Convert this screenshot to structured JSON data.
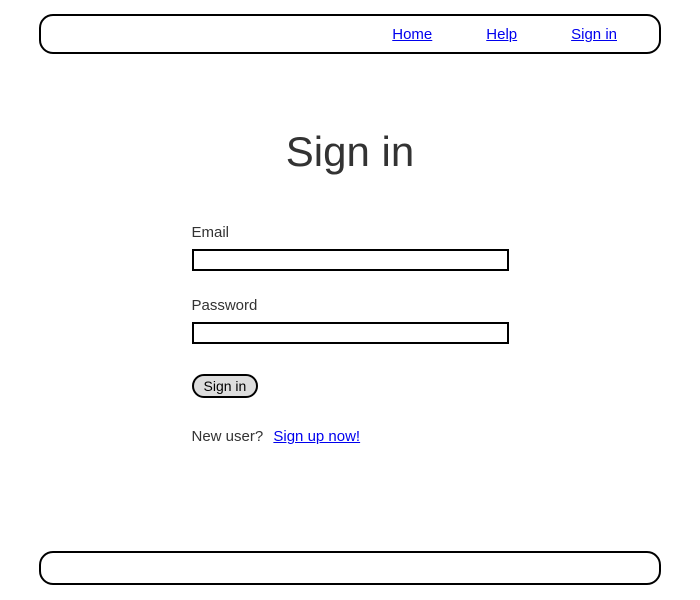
{
  "nav": {
    "home": "Home",
    "help": "Help",
    "signin": "Sign in"
  },
  "page": {
    "title": "Sign in"
  },
  "form": {
    "email_label": "Email",
    "email_value": "",
    "password_label": "Password",
    "password_value": "",
    "submit_label": "Sign in"
  },
  "signup": {
    "prompt": "New user?",
    "link_text": "Sign up now!"
  }
}
